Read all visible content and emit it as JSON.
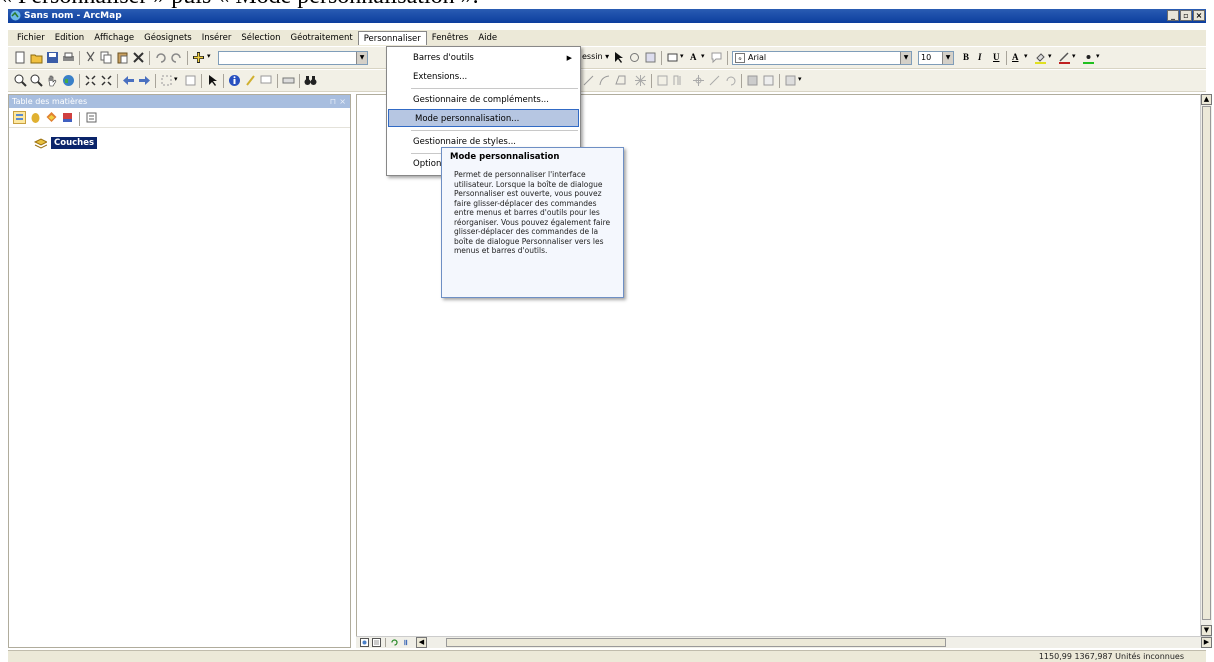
{
  "caption": "« Personnaliser » puis « Mode personnalisation ».",
  "window": {
    "title": "Sans nom - ArcMap",
    "buttons": [
      "_",
      "▫",
      "×"
    ]
  },
  "menubar": [
    "Fichier",
    "Edition",
    "Affichage",
    "Géosignets",
    "Insérer",
    "Sélection",
    "Géotraitement",
    "Personnaliser",
    "Fenêtres",
    "Aide"
  ],
  "dropdown": {
    "items": [
      {
        "label": "Barres d'outils",
        "submenu": true
      },
      {
        "label": "Extensions..."
      },
      {
        "label": "Gestionnaire de compléments..."
      },
      {
        "label": "Mode personnalisation...",
        "highlighted": true
      },
      {
        "label": "Gestionnaire de styles..."
      },
      {
        "label": "Options"
      }
    ]
  },
  "tooltip": {
    "title": "Mode personnalisation",
    "body": "Permet de personnaliser l'interface utilisateur. Lorsque la boîte de dialogue Personnaliser est ouverte, vous pouvez faire glisser-déplacer des commandes entre menus et barres d'outils pour les réorganiser. Vous pouvez également faire glisser-déplacer des commandes de la boîte de dialogue Personnaliser vers les menus et barres d'outils."
  },
  "toolbar": {
    "dessin_label": "essin",
    "font_name": "Arial",
    "font_size": "10",
    "bold": "B",
    "italic": "I",
    "underline": "U",
    "font_color": "A"
  },
  "toc": {
    "title": "Table des matières",
    "pin": "⊓",
    "close": "×",
    "layer": "Couches"
  },
  "status": {
    "coords": "1150,99  1367,987 Unités inconnues"
  },
  "colors": {
    "titlebar": "#0c3e9e",
    "menubar": "#ece9d8",
    "highlight": "#b6c6e2",
    "toc_header": "#a8bedf",
    "selected_layer": "#0a246a"
  }
}
